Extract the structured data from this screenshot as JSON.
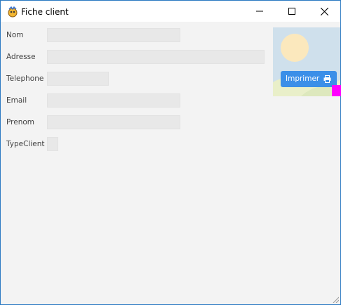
{
  "window": {
    "title": "Fiche client"
  },
  "form": {
    "fields": [
      {
        "label": "Nom",
        "value": ""
      },
      {
        "label": "Adresse",
        "value": ""
      },
      {
        "label": "Telephone",
        "value": ""
      },
      {
        "label": "Email",
        "value": ""
      },
      {
        "label": "Prenom",
        "value": ""
      },
      {
        "label": "TypeClient",
        "value": ""
      }
    ]
  },
  "toolbar": {
    "print_label": "Imprimer",
    "print_icon": "printer-icon"
  },
  "colors": {
    "accent": "#3b8fe8",
    "marker": "#ff00ff",
    "window_border": "#2b79c2"
  }
}
